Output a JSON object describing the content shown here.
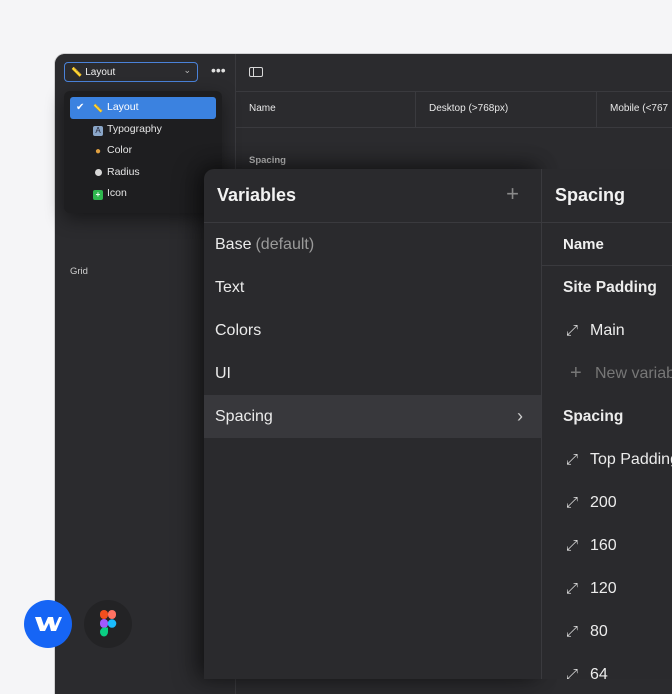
{
  "toolbar": {
    "collection_select_value": "Layout",
    "more_label": "•••"
  },
  "collections_dropdown": {
    "items": [
      {
        "label": "Layout",
        "icon": "ruler-icon",
        "selected": true
      },
      {
        "label": "Typography",
        "icon": "typography-icon",
        "selected": false
      },
      {
        "label": "Color",
        "icon": "palette-icon",
        "selected": false
      },
      {
        "label": "Radius",
        "icon": "radius-icon",
        "selected": false
      },
      {
        "label": "Icon",
        "icon": "plus-square-icon",
        "selected": false
      }
    ]
  },
  "table": {
    "columns": [
      "Name",
      "Desktop (>768px)",
      "Mobile (<767"
    ],
    "group_label": "Spacing"
  },
  "sidebar": {
    "grid_label": "Grid"
  },
  "variables_panel": {
    "title": "Variables",
    "items": [
      {
        "label": "Base",
        "suffix": "(default)"
      },
      {
        "label": "Text",
        "suffix": ""
      },
      {
        "label": "Colors",
        "suffix": ""
      },
      {
        "label": "UI",
        "suffix": ""
      },
      {
        "label": "Spacing",
        "suffix": ""
      }
    ],
    "selected_item": "Spacing"
  },
  "spacing_panel": {
    "title": "Spacing",
    "column_header": "Name",
    "rows": [
      {
        "type": "group",
        "label": "Site Padding"
      },
      {
        "type": "var",
        "label": "Main"
      },
      {
        "type": "new",
        "label": "New variab"
      },
      {
        "type": "group",
        "label": "Spacing"
      },
      {
        "type": "var",
        "label": "Top Padding"
      },
      {
        "type": "var",
        "label": "200"
      },
      {
        "type": "var",
        "label": "160"
      },
      {
        "type": "var",
        "label": "120"
      },
      {
        "type": "var",
        "label": "80"
      },
      {
        "type": "var",
        "label": "64"
      }
    ]
  },
  "colors": {
    "accent": "#3b82e0",
    "webflow": "#1665f5",
    "panel_bg": "#2a2a2d"
  }
}
